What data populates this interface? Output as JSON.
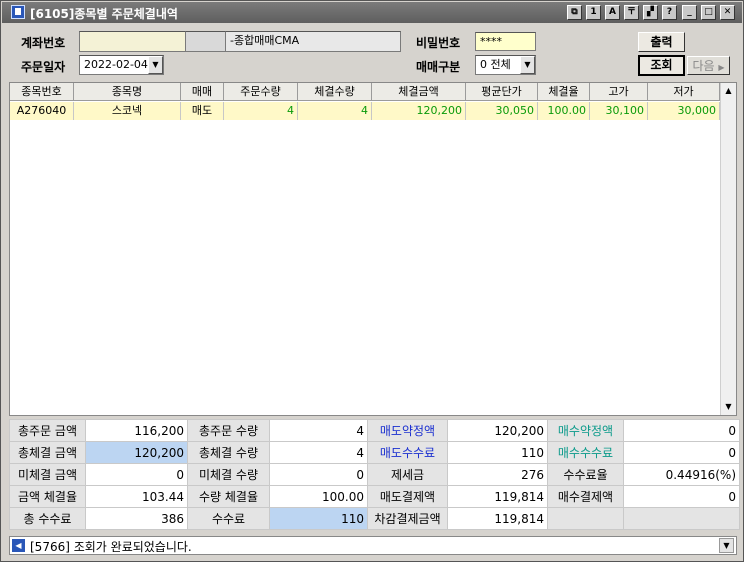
{
  "window": {
    "title": "[6105]종목별 주문체결내역",
    "buttons": [
      "⧉",
      "1",
      "A",
      "〒",
      "▞",
      "?",
      "_",
      "□",
      "✕"
    ]
  },
  "form": {
    "account_label": "계좌번호",
    "account_name": "-종합매매CMA",
    "password_label": "비밀번호",
    "password_value": "****",
    "order_date_label": "주문일자",
    "order_date_value": "2022-02-04",
    "trade_type_label": "매매구분",
    "trade_type_value": "0 전체",
    "print_button": "출력",
    "query_button": "조회",
    "next_button": "다음"
  },
  "grid": {
    "columns": [
      "종목번호",
      "종목명",
      "매매",
      "주문수량",
      "체결수량",
      "체결금액",
      "평균단가",
      "체결율",
      "고가",
      "저가"
    ],
    "rows": [
      [
        "A276040",
        "스코넥",
        "매도",
        "4",
        "4",
        "120,200",
        "30,050",
        "100.00",
        "30,100",
        "30,000"
      ]
    ]
  },
  "summary": {
    "rows": [
      [
        {
          "label": "총주문 금액",
          "value": "116,200"
        },
        {
          "label": "총주문 수량",
          "value": "4"
        },
        {
          "label": "매도약정액",
          "value": "120,200",
          "label_color": "blue"
        },
        {
          "label": "매수약정액",
          "value": "0",
          "label_color": "teal"
        }
      ],
      [
        {
          "label": "총체결 금액",
          "value": "120,200",
          "highlight": true
        },
        {
          "label": "총체결 수량",
          "value": "4"
        },
        {
          "label": "매도수수료",
          "value": "110",
          "label_color": "blue"
        },
        {
          "label": "매수수수료",
          "value": "0",
          "label_color": "teal"
        }
      ],
      [
        {
          "label": "미체결 금액",
          "value": "0"
        },
        {
          "label": "미체결 수량",
          "value": "0"
        },
        {
          "label": "제세금",
          "value": "276"
        },
        {
          "label": "수수료율",
          "value": "0.44916(%)"
        }
      ],
      [
        {
          "label": "금액 체결율",
          "value": "103.44"
        },
        {
          "label": "수량 체결율",
          "value": "100.00"
        },
        {
          "label": "매도결제액",
          "value": "119,814"
        },
        {
          "label": "매수결제액",
          "value": "0"
        }
      ],
      [
        {
          "label": "총 수수료",
          "value": "386"
        },
        {
          "label": "수수료",
          "value": "110",
          "highlight": true
        },
        {
          "label": "차감결제금액",
          "value": "119,814"
        },
        {
          "label": "",
          "value": ""
        }
      ]
    ]
  },
  "status": {
    "message": "[5766] 조회가 완료되었습니다."
  },
  "colors": {
    "grid_numbers": "#0a9a0a",
    "blue_label": "#1a2fd0",
    "teal_label": "#0a9a8a",
    "highlight": "#bcd5f2",
    "selected_row": "#fff9c8"
  }
}
